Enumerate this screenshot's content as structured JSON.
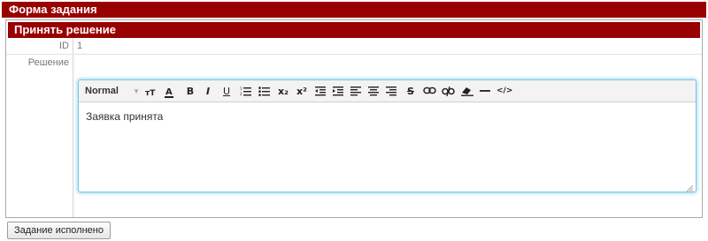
{
  "page": {
    "header_title": "Форма задания"
  },
  "panel": {
    "title": "Принять решение",
    "fields": {
      "id": {
        "label": "ID",
        "value": "1"
      },
      "decision": {
        "label": "Решение"
      }
    }
  },
  "editor": {
    "format_value": "Normal",
    "content": "Заявка принята",
    "toolbar": {
      "bold": "B",
      "italic": "I",
      "underline": "U",
      "subscript": "x₂",
      "superscript": "x²",
      "strike": "S",
      "source": "</>"
    },
    "icons": [
      "text-size-icon",
      "font-color-icon",
      "bold-icon",
      "italic-icon",
      "underline-icon",
      "ordered-list-icon",
      "unordered-list-icon",
      "subscript-icon",
      "superscript-icon",
      "outdent-icon",
      "indent-icon",
      "align-left-icon",
      "align-center-icon",
      "align-right-icon",
      "strikethrough-icon",
      "link-icon",
      "unlink-icon",
      "eraser-icon",
      "horizontal-rule-icon",
      "code-icon"
    ]
  },
  "actions": {
    "submit_label": "Задание исполнено"
  },
  "colors": {
    "header_bg": "#990000",
    "editor_focus": "#7cc6e6"
  }
}
